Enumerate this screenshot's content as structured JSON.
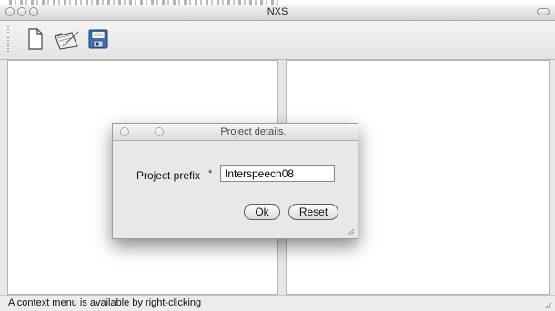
{
  "window": {
    "title": "NXS"
  },
  "toolbar": {
    "buttons": [
      {
        "icon": "new-document-icon",
        "tooltip": ""
      },
      {
        "icon": "open-folder-icon",
        "tooltip": ""
      },
      {
        "icon": "save-disk-icon",
        "tooltip": ""
      }
    ]
  },
  "status": {
    "text": "A context menu is available by right-clicking"
  },
  "dialog": {
    "title": "Project details.",
    "label": "Project prefix",
    "required_marker": "*",
    "input_value": "Interspeech08",
    "ok_label": "Ok",
    "reset_label": "Reset"
  },
  "colors": {
    "dialog_background": "#e8e8e8",
    "window_background": "#ffffff",
    "save_icon_blue": "#3f6fb5"
  }
}
